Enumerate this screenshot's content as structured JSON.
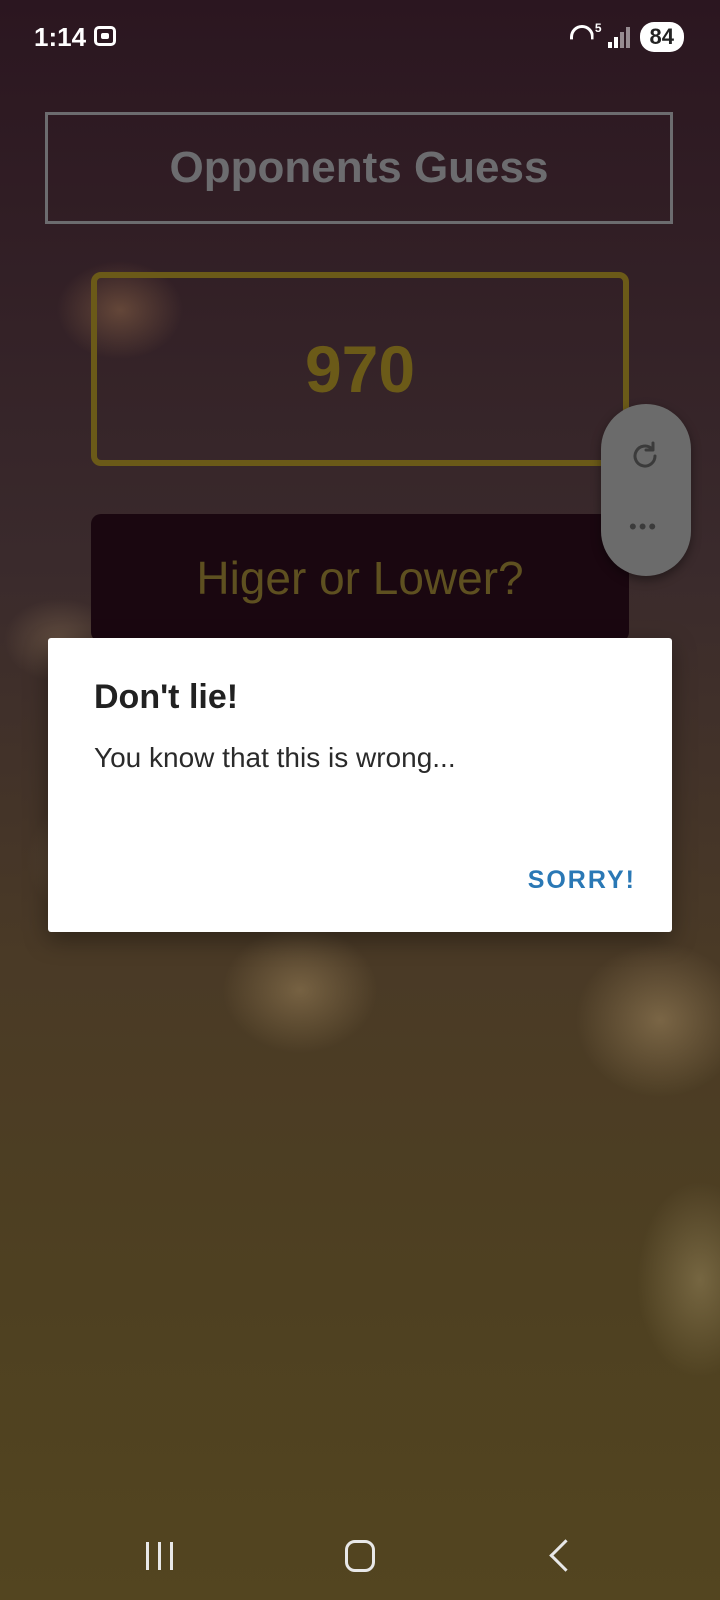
{
  "status_bar": {
    "time": "1:14",
    "battery": "84",
    "wifi_label": "5"
  },
  "game": {
    "title": "Opponents Guess",
    "guess_value": "970",
    "prompt": "Higer or Lower?"
  },
  "float_panel": {
    "refresh_icon": "refresh-icon",
    "more_icon": "more-icon",
    "more_label": "•••"
  },
  "dialog": {
    "title": "Don't lie!",
    "message": "You know that this is wrong...",
    "button_label": "SORRY!",
    "button_color": "#2a78b5"
  },
  "colors": {
    "guess_border": "#6b5a18",
    "title_border": "#6c6c6f",
    "prompt_bg": "#1a0710"
  }
}
